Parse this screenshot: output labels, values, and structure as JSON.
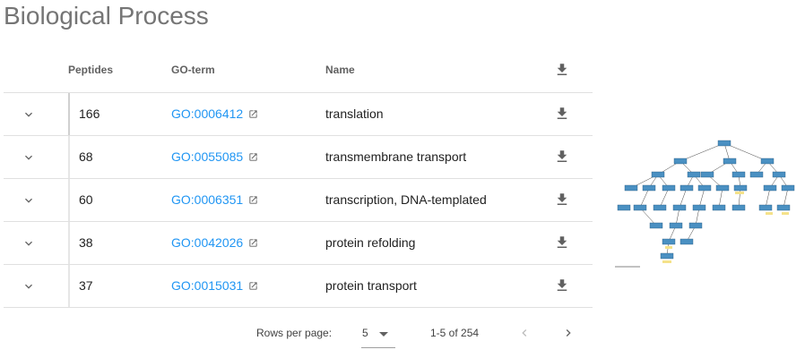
{
  "page": {
    "title": "Biological Process"
  },
  "table": {
    "columns": {
      "peptides": "Peptides",
      "goterm": "GO-term",
      "name": "Name"
    },
    "rows": [
      {
        "peptides": "166",
        "go": "GO:0006412",
        "name": "translation"
      },
      {
        "peptides": "68",
        "go": "GO:0055085",
        "name": "transmembrane transport"
      },
      {
        "peptides": "60",
        "go": "GO:0006351",
        "name": "transcription, DNA-templated"
      },
      {
        "peptides": "38",
        "go": "GO:0042026",
        "name": "protein refolding"
      },
      {
        "peptides": "37",
        "go": "GO:0015031",
        "name": "protein transport"
      }
    ]
  },
  "pagination": {
    "rows_per_page_label": "Rows per page:",
    "rows_per_page_value": "5",
    "range_text": "1-5 of 254"
  },
  "colors": {
    "link": "#2196f3",
    "title": "#757575"
  },
  "icons": [
    "chevron-down-icon",
    "download-icon",
    "external-link-icon",
    "chevron-left-icon",
    "chevron-right-icon"
  ]
}
